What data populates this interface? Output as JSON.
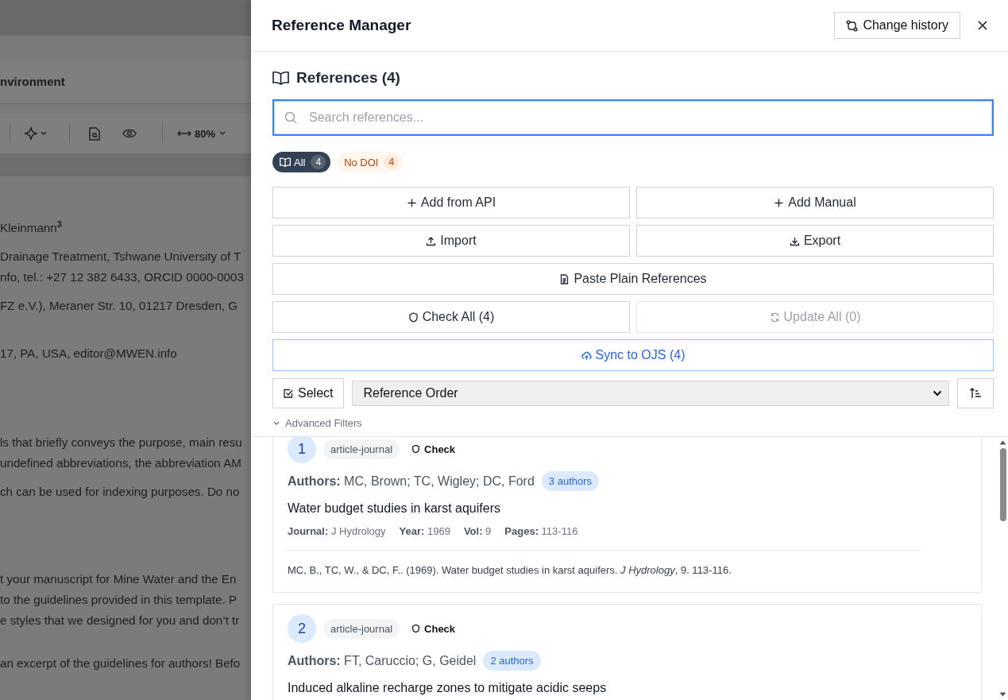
{
  "document": {
    "title": "nvironment",
    "toolbar": {
      "zoom": "80%"
    },
    "blocks": [
      [
        "Kleinmann$^{3}$"
      ],
      [
        "Drainage Treatment, Tshwane University of T",
        "nfo, tel.: +27 12 382 6433, ORCID 0000-0003"
      ],
      [
        "FZ e.V.), Meraner Str. 10, 01217 Dresden, G"
      ],
      [
        "17, PA, USA, editor@MWEN.info"
      ],
      [
        "ls that briefly conveys the purpose, main resu",
        "undefined abbreviations, the abbreviation AM"
      ],
      [
        "ch can be used for indexing purposes. Do no"
      ],
      [
        "t your manuscript for Mine Water and the En",
        "to the guidelines provided in this template. P",
        "e styles that we designed for you and don’t tr"
      ],
      [
        "an excerpt of the guidelines for authors! Befo"
      ]
    ]
  },
  "panel": {
    "title": "Reference Manager",
    "history_button": "Change history",
    "section_title": "References (4)",
    "search": {
      "placeholder": "Search references..."
    },
    "chips": [
      {
        "label": "All",
        "count": "4",
        "kind": "all",
        "selected": true
      },
      {
        "label": "No DOI",
        "count": "4",
        "kind": "missing-doi",
        "selected": false
      }
    ],
    "action_rows": [
      [
        {
          "label": "Add from API",
          "kind": "add",
          "disabled": false,
          "primary": false
        },
        {
          "label": "Add Manual",
          "kind": "add",
          "disabled": false,
          "primary": false
        }
      ],
      [
        {
          "label": "Import",
          "kind": "import",
          "disabled": false,
          "primary": false
        },
        {
          "label": "Export",
          "kind": "export",
          "disabled": false,
          "primary": false
        }
      ],
      [
        {
          "label": "Paste Plain References",
          "kind": "paste",
          "disabled": false,
          "primary": false
        }
      ],
      [
        {
          "label": "Check All (4)",
          "kind": "check",
          "disabled": false,
          "primary": false
        },
        {
          "label": "Update All (0)",
          "kind": "update",
          "disabled": true,
          "primary": false
        }
      ],
      [
        {
          "label": "Sync to OJS (4)",
          "kind": "sync",
          "disabled": false,
          "primary": true
        }
      ]
    ],
    "select_button": "Select",
    "sort": {
      "value": "Reference Order"
    },
    "advanced_filters": {
      "label": "Advanced Filters",
      "expanded": false
    },
    "references": [
      {
        "number": "1",
        "type": "article-journal",
        "check": "Check",
        "authors": "**Authors:** MC, Brown; TC, Wigley; DC, Ford",
        "author_count": "3 authors",
        "title": "Water budget studies in karst aquifers",
        "meta": [
          {
            "label": "Journal:",
            "value": "J Hydrology"
          },
          {
            "label": "Year:",
            "value": "1969"
          },
          {
            "label": "Vol:",
            "value": "9"
          },
          {
            "label": "Pages:",
            "value": "113-116"
          }
        ],
        "citation": "MC, B., TC, W., & DC, F.. (1969). Water budget studies in karst aquifers. *J Hydrology*, 9. 113-116."
      },
      {
        "number": "2",
        "type": "article-journal",
        "check": "Check",
        "authors": "**Authors:** FT, Caruccio; G, Geidel",
        "author_count": "2 authors",
        "title": "Induced alkaline recharge zones to mitigate acidic seeps"
      }
    ]
  }
}
